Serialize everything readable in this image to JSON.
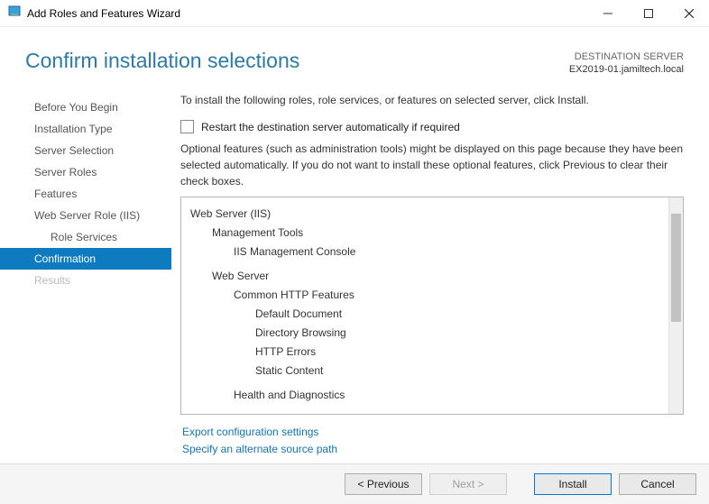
{
  "window": {
    "title": "Add Roles and Features Wizard"
  },
  "header": {
    "title": "Confirm installation selections",
    "dest_label": "DESTINATION SERVER",
    "dest_name": "EX2019-01.jamiltech.local"
  },
  "sidebar": {
    "items": [
      {
        "label": "Before You Begin",
        "state": "normal"
      },
      {
        "label": "Installation Type",
        "state": "normal"
      },
      {
        "label": "Server Selection",
        "state": "normal"
      },
      {
        "label": "Server Roles",
        "state": "normal"
      },
      {
        "label": "Features",
        "state": "normal"
      },
      {
        "label": "Web Server Role (IIS)",
        "state": "normal"
      },
      {
        "label": "Role Services",
        "state": "normal",
        "sub": true
      },
      {
        "label": "Confirmation",
        "state": "active"
      },
      {
        "label": "Results",
        "state": "disabled"
      }
    ]
  },
  "content": {
    "intro": "To install the following roles, role services, or features on selected server, click Install.",
    "restart_checkbox_label": "Restart the destination server automatically if required",
    "optional_text": "Optional features (such as administration tools) might be displayed on this page because they have been selected automatically. If you do not want to install these optional features, click Previous to clear their check boxes.",
    "tree": [
      {
        "label": "Web Server (IIS)",
        "level": 0
      },
      {
        "label": "Management Tools",
        "level": 1
      },
      {
        "label": "IIS Management Console",
        "level": 2
      },
      {
        "label": "Web Server",
        "level": 1
      },
      {
        "label": "Common HTTP Features",
        "level": 2
      },
      {
        "label": "Default Document",
        "level": 3
      },
      {
        "label": "Directory Browsing",
        "level": 3
      },
      {
        "label": "HTTP Errors",
        "level": 3
      },
      {
        "label": "Static Content",
        "level": 3
      },
      {
        "label": "Health and Diagnostics",
        "level": 2
      }
    ],
    "links": {
      "export": "Export configuration settings",
      "alternate": "Specify an alternate source path"
    }
  },
  "footer": {
    "previous": "< Previous",
    "next": "Next >",
    "install": "Install",
    "cancel": "Cancel"
  }
}
